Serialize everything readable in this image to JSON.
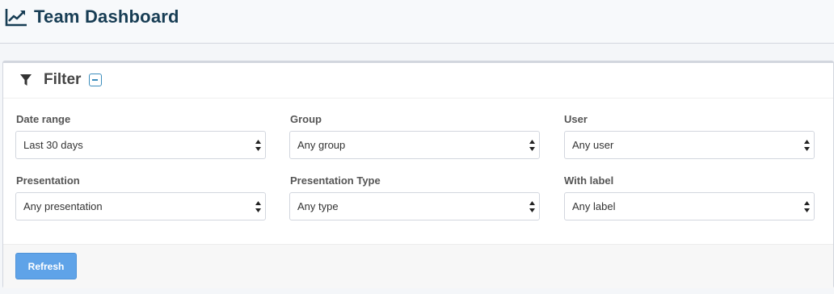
{
  "header": {
    "title": "Team Dashboard",
    "icon": "line-chart-icon"
  },
  "filter_box": {
    "title": "Filter",
    "icon": "filter-icon",
    "collapse_icon": "minus-square-icon",
    "fields": {
      "date_range": {
        "label": "Date range",
        "value": "Last 30 days"
      },
      "group": {
        "label": "Group",
        "value": "Any group"
      },
      "user": {
        "label": "User",
        "value": "Any user"
      },
      "presentation": {
        "label": "Presentation",
        "value": "Any presentation"
      },
      "presentation_type": {
        "label": "Presentation Type",
        "value": "Any type"
      },
      "with_label": {
        "label": "With label",
        "value": "Any label"
      }
    },
    "refresh_label": "Refresh"
  },
  "colors": {
    "title": "#173d54",
    "accent": "#3c8dbc",
    "button": "#5fa3e8"
  }
}
